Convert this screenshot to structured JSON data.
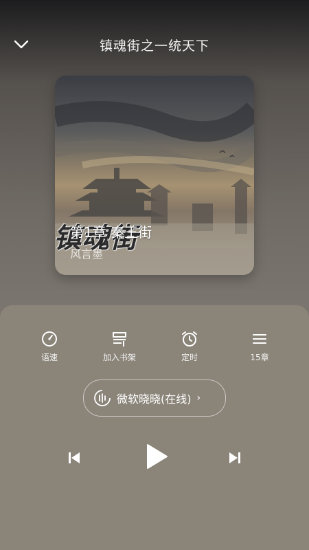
{
  "header": {
    "title": "镇魂街之一统天下",
    "back_icon": "chevron-down-icon"
  },
  "cover": {
    "art_title": "镇魂街",
    "chapter": "第1章 秦王街",
    "author": "风言墨"
  },
  "tools": [
    {
      "label": "语速",
      "icon": "speed-icon"
    },
    {
      "label": "加入书架",
      "icon": "bookshelf-icon"
    },
    {
      "label": "定时",
      "icon": "alarm-clock-icon"
    },
    {
      "label": "15章",
      "icon": "chapter-list-icon"
    }
  ],
  "voice": {
    "label": "微软晓晓(在线)",
    "arrow": "›",
    "icon": "voice-wave-icon"
  },
  "controls": {
    "prev_icon": "skip-previous-icon",
    "play_icon": "play-icon",
    "next_icon": "skip-next-icon"
  },
  "colors": {
    "panel": "#8a8479",
    "text": "#ffffff"
  }
}
